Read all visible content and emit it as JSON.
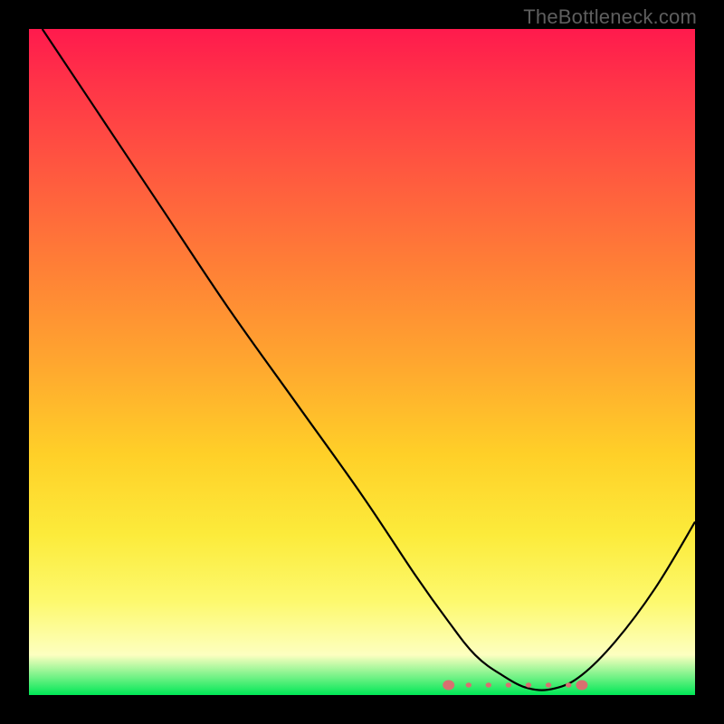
{
  "watermark": "TheBottleneck.com",
  "chart_data": {
    "type": "line",
    "title": "",
    "xlabel": "",
    "ylabel": "",
    "xlim": [
      0,
      100
    ],
    "ylim": [
      0,
      100
    ],
    "grid": false,
    "legend": false,
    "background_gradient": {
      "direction": "vertical",
      "stops": [
        {
          "pos": 0.0,
          "color": "#ff1a4d"
        },
        {
          "pos": 0.5,
          "color": "#ffa62f"
        },
        {
          "pos": 0.86,
          "color": "#fdf96e"
        },
        {
          "pos": 1.0,
          "color": "#00e756"
        }
      ]
    },
    "series": [
      {
        "name": "bottleneck-curve",
        "x": [
          2,
          10,
          20,
          30,
          40,
          50,
          58,
          63,
          67,
          71,
          75,
          79,
          83,
          88,
          94,
          100
        ],
        "y": [
          100,
          88,
          73,
          58,
          44,
          30,
          18,
          11,
          6,
          3,
          1,
          1,
          3,
          8,
          16,
          26
        ]
      }
    ],
    "minimum_band": {
      "x_start": 63,
      "x_end": 83,
      "markers_x": [
        63,
        66,
        69,
        72,
        75,
        78,
        81,
        83
      ],
      "marker_y": 1.5,
      "color": "#d87070"
    }
  }
}
